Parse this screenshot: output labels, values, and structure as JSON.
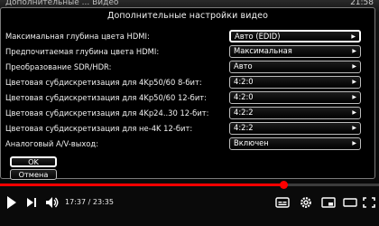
{
  "background": {
    "label": "Дополнительные ... Видео",
    "time": "21:58"
  },
  "dialog": {
    "title": "Дополнительные настройки видео",
    "rows": [
      {
        "label": "Максимальная глубина цвета HDMI:",
        "value": "Авто (EDID)",
        "active": true
      },
      {
        "label": "Предпочитаемая глубина цвета HDMI:",
        "value": "Максимальная",
        "active": false
      },
      {
        "label": "Преобразование SDR/HDR:",
        "value": "Авто",
        "active": false
      },
      {
        "label": "Цветовая субдискретизация для 4Kp50/60 8-бит:",
        "value": "4:2:0",
        "active": false
      },
      {
        "label": "Цветовая субдискретизация для 4Kp50/60 12-бит:",
        "value": "4:2:0",
        "active": false
      },
      {
        "label": "Цветовая субдискретизация для 4Kp24..30 12-бит:",
        "value": "4:2:2",
        "active": false
      },
      {
        "label": "Цветовая субдискретизация для не-4K 12-бит:",
        "value": "4:2:2",
        "active": false
      },
      {
        "label": "Аналоговый A/V-выход:",
        "value": "Включен",
        "active": false
      }
    ],
    "ok_label": "OK",
    "cancel_label": "Отмена"
  },
  "player": {
    "current_time": "17:37",
    "separator": "/",
    "duration": "23:35",
    "progress_fraction": 0.747,
    "accent_color": "#ff0000"
  },
  "icons": {
    "play": "play-icon",
    "next": "next-icon",
    "volume": "volume-icon",
    "subtitles": "subtitles-icon",
    "settings": "gear-icon",
    "miniplayer": "miniplayer-icon",
    "theater": "theater-icon",
    "fullscreen": "fullscreen-icon"
  }
}
